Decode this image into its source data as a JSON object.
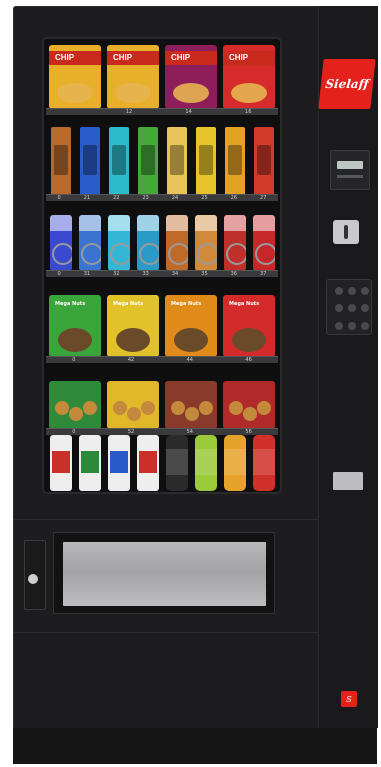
{
  "brand": {
    "name": "Sielaff"
  },
  "shelves": [
    {
      "kind": "chips",
      "labels": [
        "",
        "12",
        "14",
        "16"
      ],
      "items": [
        {
          "text": "CHIP",
          "band": "#c92a1e",
          "body": "#e8b02a"
        },
        {
          "text": "CHIP",
          "band": "#c92a1e",
          "body": "#e8b02a"
        },
        {
          "text": "CHIP",
          "band": "#c92a1e",
          "body": "#8e1e5b"
        },
        {
          "text": "CHIP",
          "band": "#c92a1e",
          "body": "#d72b2b"
        }
      ]
    },
    {
      "kind": "bars",
      "labels": [
        "0",
        "21",
        "22",
        "23",
        "24",
        "25",
        "26",
        "27"
      ],
      "items": [
        {
          "color": "#b9692a"
        },
        {
          "color": "#2a5cc9"
        },
        {
          "color": "#2bbbc9"
        },
        {
          "color": "#47a83a"
        },
        {
          "color": "#e8c35a"
        },
        {
          "color": "#e8c42a"
        },
        {
          "color": "#e3a224"
        },
        {
          "color": "#d13a2a"
        }
      ]
    },
    {
      "kind": "pouches",
      "labels": [
        "0",
        "31",
        "32",
        "33",
        "34",
        "35",
        "36",
        "37"
      ],
      "items": [
        {
          "color": "#3a4ad0"
        },
        {
          "color": "#3a74d0"
        },
        {
          "color": "#35b6d6"
        },
        {
          "color": "#2a9bc9"
        },
        {
          "color": "#c06a2a"
        },
        {
          "color": "#d08a3a"
        },
        {
          "color": "#c0302a"
        },
        {
          "color": "#c6282a"
        }
      ]
    },
    {
      "kind": "snacks",
      "labels": [
        "0",
        "42",
        "44",
        "46"
      ],
      "items": [
        {
          "text": "Mega Nuts",
          "color": "#39a53a"
        },
        {
          "text": "Mega Nuts",
          "color": "#e2c22a"
        },
        {
          "text": "Mega Nuts",
          "color": "#e08a1a"
        },
        {
          "text": "Mega Nuts",
          "color": "#d42a2a"
        }
      ]
    },
    {
      "kind": "cookies",
      "labels": [
        "0",
        "52",
        "54",
        "56"
      ],
      "items": [
        {
          "color": "#2f8b3a"
        },
        {
          "color": "#e0b82a"
        },
        {
          "color": "#8a3a2a"
        },
        {
          "color": "#b02a2a"
        }
      ]
    },
    {
      "kind": "drinks",
      "labels": [],
      "items": [
        {
          "type": "cup",
          "color": "#c9302a"
        },
        {
          "type": "cup",
          "color": "#2a8a3a"
        },
        {
          "type": "cup",
          "color": "#2a5ac9"
        },
        {
          "type": "cup",
          "color": "#c9302a"
        },
        {
          "type": "can",
          "color": "#2b2b2b"
        },
        {
          "type": "can",
          "color": "#9ac93a"
        },
        {
          "type": "can",
          "color": "#e6a22a"
        },
        {
          "type": "can",
          "color": "#d0302a"
        }
      ]
    }
  ],
  "colors": {
    "cabinet": "#1d1d1f",
    "brand_red": "#e4221b",
    "flap": "#b0b0b2"
  },
  "icons": {
    "coin": "coin-slot-icon",
    "keypad": "keypad-icon",
    "lock": "lock-icon"
  }
}
